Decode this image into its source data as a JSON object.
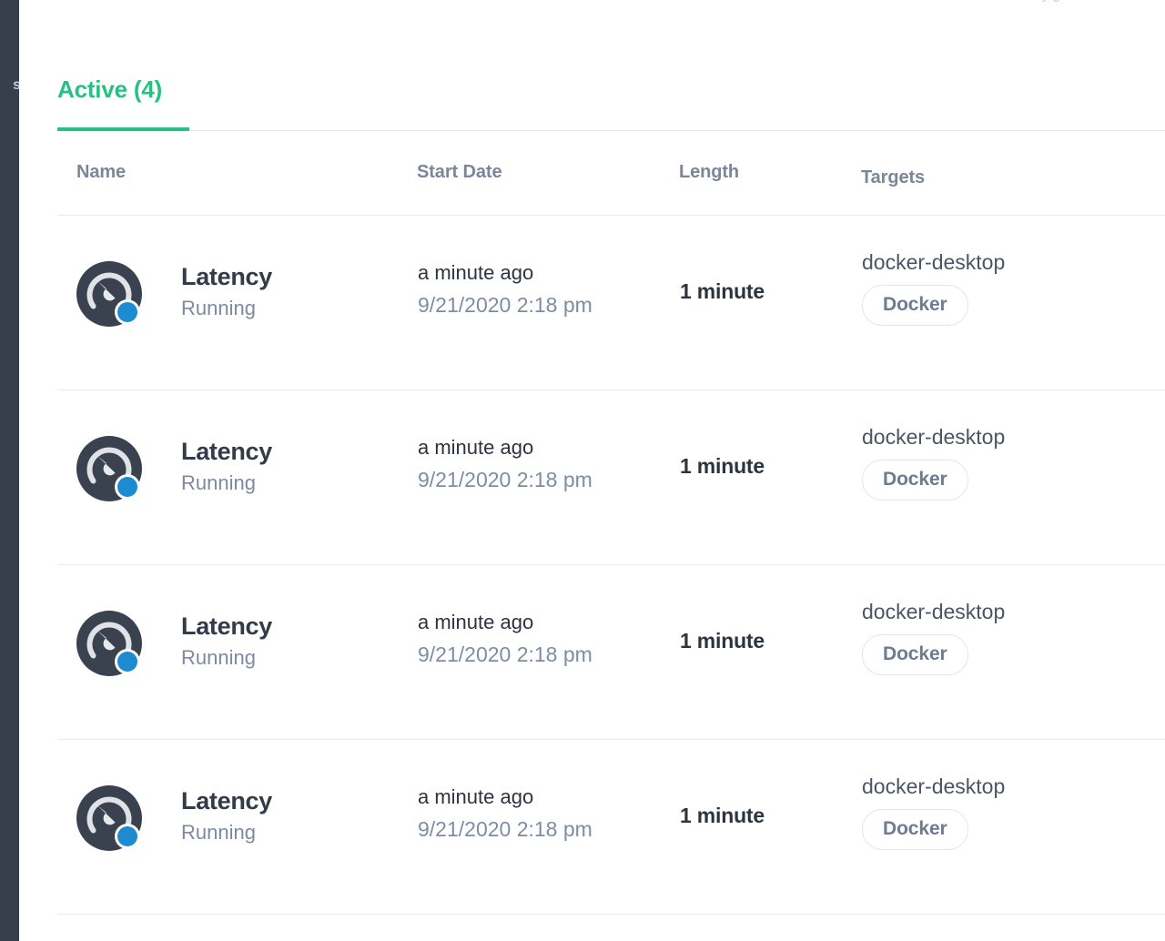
{
  "colors": {
    "accent_green": "#24c183",
    "rail_dark": "#373f4d",
    "icon_circle": "#3a4250",
    "status_dot_blue": "#1e8bd0",
    "heading_gray": "#7c869b",
    "text_dark": "#2c3440",
    "text_muted": "#7e8da4",
    "divider": "#e7e9ec",
    "badge_border": "#e2e5e9",
    "badge_text": "#6d7b93"
  },
  "rail": {
    "clipped_label": "s"
  },
  "header": {
    "clipped_text": "y                                            g"
  },
  "tabs": [
    {
      "id": "active",
      "label": "Active (4)",
      "selected": true
    }
  ],
  "table": {
    "columns": [
      {
        "key": "name",
        "label": "Name"
      },
      {
        "key": "start",
        "label": "Start Date"
      },
      {
        "key": "length",
        "label": "Length"
      },
      {
        "key": "targets",
        "label": "Targets"
      }
    ],
    "rows": [
      {
        "icon": "gauge-icon",
        "status_dot": "running-dot",
        "name": "Latency",
        "status": "Running",
        "start_relative": "a minute ago",
        "start_absolute": "9/21/2020 2:18 pm",
        "length": "1 minute",
        "target_host": "docker-desktop",
        "target_badge": "Docker"
      },
      {
        "icon": "gauge-icon",
        "status_dot": "running-dot",
        "name": "Latency",
        "status": "Running",
        "start_relative": "a minute ago",
        "start_absolute": "9/21/2020 2:18 pm",
        "length": "1 minute",
        "target_host": "docker-desktop",
        "target_badge": "Docker"
      },
      {
        "icon": "gauge-icon",
        "status_dot": "running-dot",
        "name": "Latency",
        "status": "Running",
        "start_relative": "a minute ago",
        "start_absolute": "9/21/2020 2:18 pm",
        "length": "1 minute",
        "target_host": "docker-desktop",
        "target_badge": "Docker"
      },
      {
        "icon": "gauge-icon",
        "status_dot": "running-dot",
        "name": "Latency",
        "status": "Running",
        "start_relative": "a minute ago",
        "start_absolute": "9/21/2020 2:18 pm",
        "length": "1 minute",
        "target_host": "docker-desktop",
        "target_badge": "Docker"
      }
    ]
  }
}
